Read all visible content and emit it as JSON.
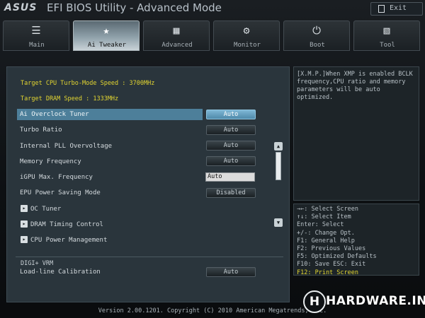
{
  "header": {
    "brand": "ASUS",
    "title": "EFI BIOS Utility - Advanced Mode",
    "exit_label": "Exit"
  },
  "tabs": [
    {
      "label": "Main",
      "icon": "list-icon",
      "active": false
    },
    {
      "label": "Ai Tweaker",
      "icon": "tweaker-icon",
      "active": true
    },
    {
      "label": "Advanced",
      "icon": "advanced-icon",
      "active": false
    },
    {
      "label": "Monitor",
      "icon": "monitor-icon",
      "active": false
    },
    {
      "label": "Boot",
      "icon": "power-icon",
      "active": false
    },
    {
      "label": "Tool",
      "icon": "tool-icon",
      "active": false
    }
  ],
  "main": {
    "info": [
      "Target CPU Turbo-Mode Speed : 3700MHz",
      "Target DRAM Speed : 1333MHz"
    ],
    "settings": [
      {
        "label": "Ai Overclock Tuner",
        "value": "Auto",
        "selected": true,
        "type": "button"
      },
      {
        "label": "Turbo Ratio",
        "value": "Auto",
        "selected": false,
        "type": "button"
      },
      {
        "label": "Internal PLL Overvoltage",
        "value": "Auto",
        "selected": false,
        "type": "button"
      },
      {
        "label": "Memory Frequency",
        "value": "Auto",
        "selected": false,
        "type": "button"
      },
      {
        "label": "iGPU Max. Frequency",
        "value": "Auto",
        "selected": false,
        "type": "field"
      },
      {
        "label": "EPU Power Saving Mode",
        "value": "Disabled",
        "selected": false,
        "type": "button"
      }
    ],
    "submenus": [
      "OC Tuner",
      "DRAM Timing Control",
      "CPU Power Management"
    ],
    "section_title": "DIGI+ VRM",
    "vrm_setting": {
      "label": "Load-line Calibration",
      "value": "Auto"
    }
  },
  "help_text": "[X.M.P.]When XMP is enabled BCLK frequency,CPU ratio and memory parameters will be auto optimized.",
  "keys": [
    "→←: Select Screen",
    "↑↓: Select Item",
    "Enter: Select",
    "+/-: Change Opt.",
    "F1: General Help",
    "F2: Previous Values",
    "F5: Optimized Defaults",
    "F10: Save  ESC: Exit",
    "F12: Print Screen"
  ],
  "footer": "Version 2.00.1201. Copyright (C) 2010 American Megatrends, Inc.",
  "watermark": {
    "letter": "H",
    "text": "HARDWARE.INFO"
  },
  "colors": {
    "accent": "#e2d531",
    "selected": "#4d7f9a",
    "panel": "#2a353c"
  }
}
